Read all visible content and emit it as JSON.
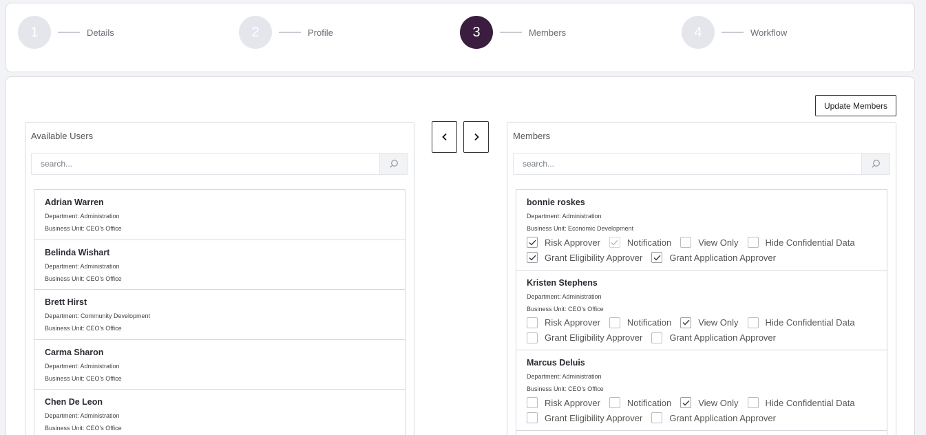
{
  "stepper": {
    "steps": [
      {
        "number": "1",
        "label": "Details"
      },
      {
        "number": "2",
        "label": "Profile"
      },
      {
        "number": "3",
        "label": "Members"
      },
      {
        "number": "4",
        "label": "Workflow"
      }
    ],
    "active_step": 3
  },
  "toolbar": {
    "update_label": "Update Members"
  },
  "arrows": {
    "left": "‹",
    "right": "›"
  },
  "available": {
    "title": "Available Users",
    "search_placeholder": "search...",
    "users": [
      {
        "name": "Adrian Warren",
        "department": "Department: Administration",
        "business_unit": "Business Unit: CEO's Office"
      },
      {
        "name": "Belinda Wishart",
        "department": "Department: Administration",
        "business_unit": "Business Unit: CEO's Office"
      },
      {
        "name": "Brett Hirst",
        "department": "Department: Community Development",
        "business_unit": "Business Unit: CEO's Office"
      },
      {
        "name": "Carma Sharon",
        "department": "Department: Administration",
        "business_unit": "Business Unit: CEO's Office"
      },
      {
        "name": "Chen De Leon",
        "department": "Department: Administration",
        "business_unit": "Business Unit: CEO's Office"
      }
    ]
  },
  "members": {
    "title": "Members",
    "search_placeholder": "search...",
    "permission_labels": {
      "risk": "Risk Approver",
      "notification": "Notification",
      "view_only": "View Only",
      "hide_confidential": "Hide Confidential Data",
      "grant_eligibility": "Grant Eligibility Approver",
      "grant_application": "Grant Application Approver"
    },
    "list": [
      {
        "name": "bonnie roskes",
        "department": "Department: Administration",
        "business_unit": "Business Unit: Economic Development",
        "risk": "checked",
        "notification": "checked-disabled",
        "view_only": "unchecked",
        "hide_confidential": "unchecked",
        "grant_eligibility": "checked",
        "grant_application": "checked"
      },
      {
        "name": "Kristen Stephens",
        "department": "Department: Administration",
        "business_unit": "Business Unit: CEO's Office",
        "risk": "unchecked",
        "notification": "unchecked",
        "view_only": "checked",
        "hide_confidential": "unchecked",
        "grant_eligibility": "unchecked",
        "grant_application": "unchecked"
      },
      {
        "name": "Marcus Deluis",
        "department": "Department: Administration",
        "business_unit": "Business Unit: CEO's Office",
        "risk": "unchecked",
        "notification": "unchecked",
        "view_only": "checked",
        "hide_confidential": "unchecked",
        "grant_eligibility": "unchecked",
        "grant_application": "unchecked"
      }
    ]
  },
  "colors": {
    "active_step": "#3b1d3f",
    "inactive_step": "#e4e6ec"
  }
}
